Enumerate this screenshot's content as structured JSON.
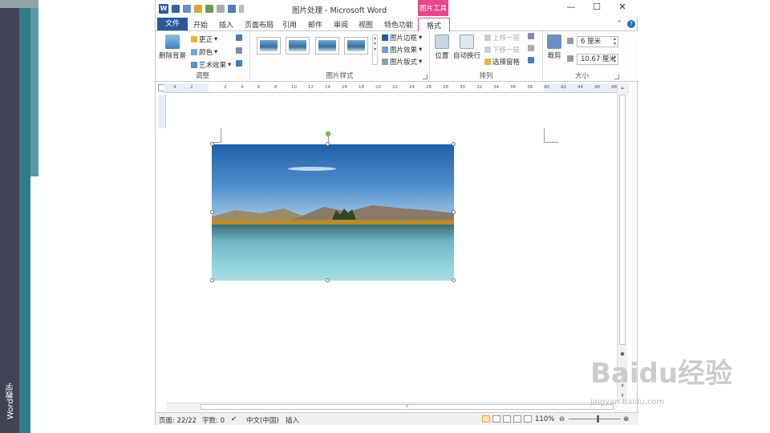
{
  "slide": {
    "side_label": "Word教学"
  },
  "window": {
    "title": "图片处理 - Microsoft Word",
    "tool_context": "图片工具",
    "controls": [
      "—",
      "☐",
      "✕"
    ]
  },
  "tabs": [
    {
      "label": "文件"
    },
    {
      "label": "开始"
    },
    {
      "label": "插入"
    },
    {
      "label": "页面布局"
    },
    {
      "label": "引用"
    },
    {
      "label": "邮件"
    },
    {
      "label": "审阅"
    },
    {
      "label": "视图"
    },
    {
      "label": "特色功能"
    },
    {
      "label": "格式"
    }
  ],
  "ribbon": {
    "adjust": {
      "label": "调整",
      "remove_bg": "删除背景",
      "correct": "更正",
      "color": "颜色",
      "art_effects": "艺术效果"
    },
    "styles": {
      "label": "图片样式",
      "border": "图片边框",
      "effects": "图片效果",
      "layout": "图片版式"
    },
    "arrange": {
      "label": "排列",
      "position": "位置",
      "wrap": "自动换行",
      "bring_forward": "上移一层",
      "send_backward": "下移一层",
      "selection_pane": "选择窗格"
    },
    "size": {
      "label": "大小",
      "crop": "裁剪",
      "height": "6 厘米",
      "width": "10.67 厘米"
    }
  },
  "ruler_numbers": [
    "4",
    "2",
    "",
    "2",
    "4",
    "6",
    "8",
    "10",
    "12",
    "14",
    "16",
    "18",
    "20",
    "22",
    "24",
    "26",
    "28",
    "30",
    "32",
    "34",
    "36",
    "38",
    "40",
    "42",
    "44",
    "46",
    "48"
  ],
  "statusbar": {
    "page": "页面: 22/22",
    "words": "字数: 0",
    "language": "中文(中国)",
    "mode": "插入",
    "zoom": "110%",
    "zoom_fraction": 0.55
  },
  "watermark": {
    "main": "Baidu经验",
    "sub": "jingyan.baidu.com"
  },
  "colors": {
    "file_tab": "#2b5797",
    "tool_context": "#e8458c",
    "accent_view": "#fbe7a3"
  }
}
